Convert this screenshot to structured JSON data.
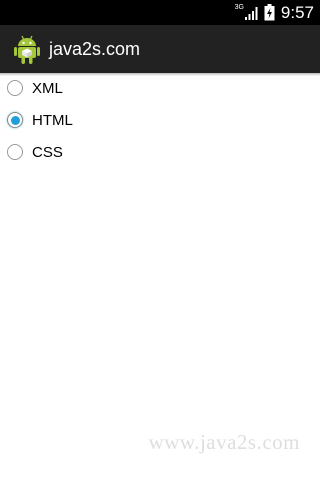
{
  "status_bar": {
    "network_type": "3G",
    "time": "9:57",
    "icons": [
      "signal-icon",
      "battery-icon"
    ]
  },
  "action_bar": {
    "title": "java2s.com",
    "icon": "android-robot-icon"
  },
  "radio_group": {
    "options": [
      {
        "label": "XML",
        "checked": false
      },
      {
        "label": "HTML",
        "checked": true
      },
      {
        "label": "CSS",
        "checked": false
      }
    ]
  },
  "watermark": "www.java2s.com",
  "colors": {
    "accent": "#1e9fdc",
    "action_bar": "#222222",
    "status_bar": "#000000",
    "android_green": "#a4c639"
  }
}
